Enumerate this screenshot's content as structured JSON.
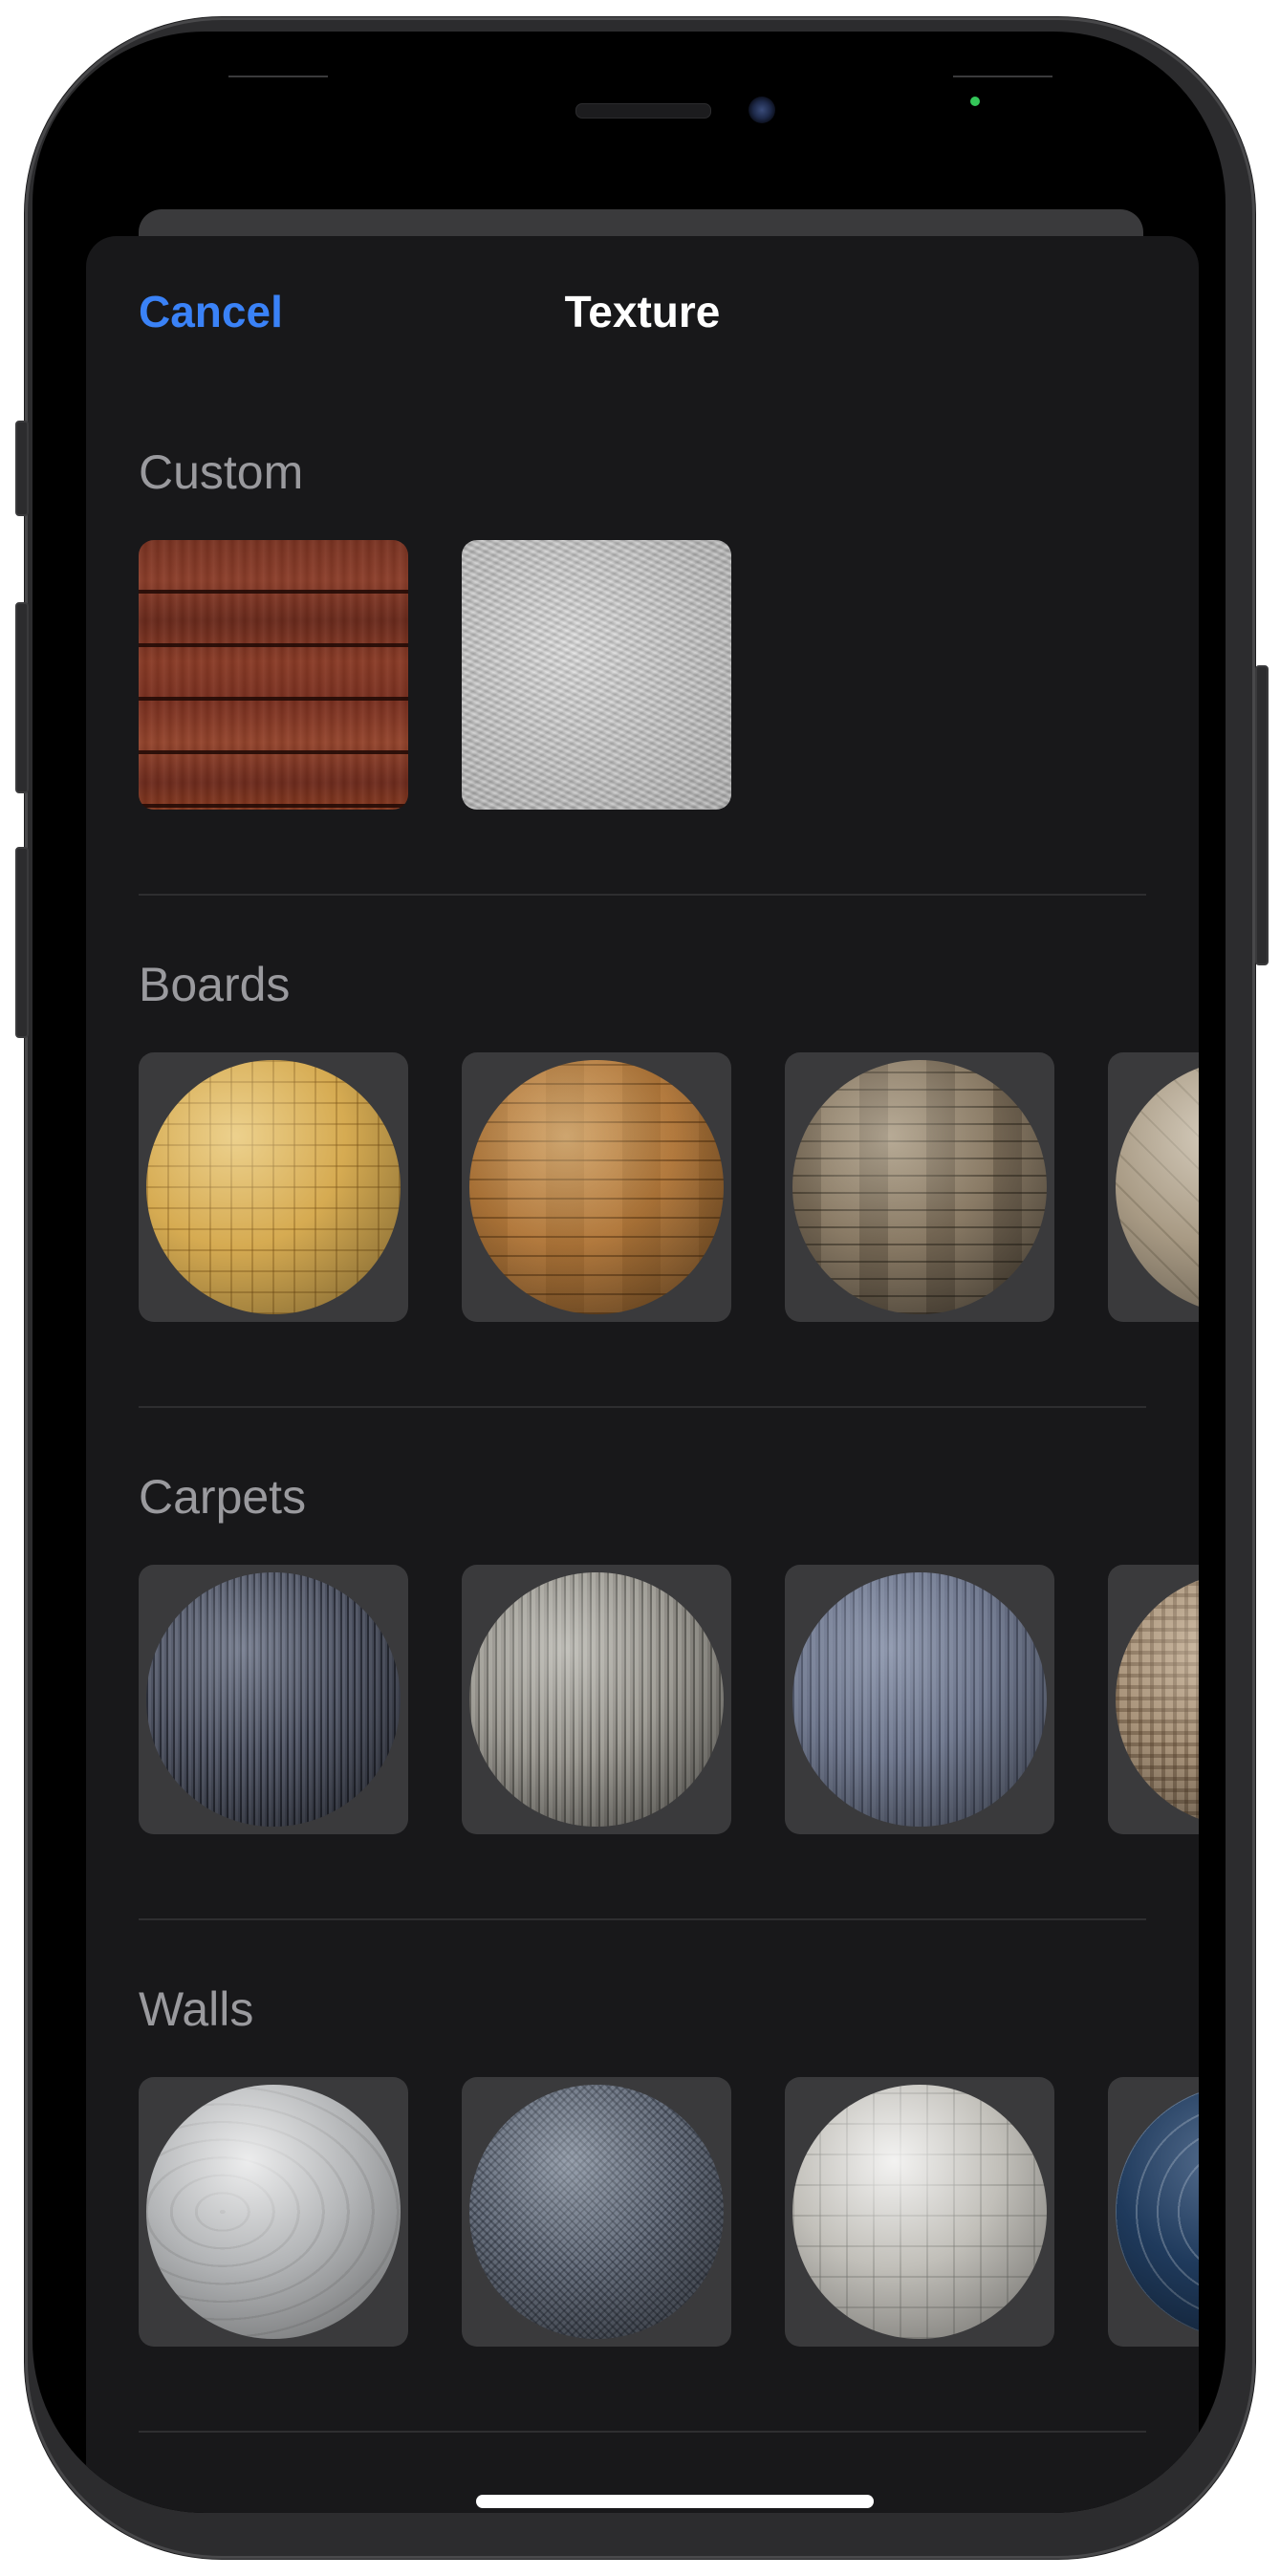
{
  "nav": {
    "cancel_label": "Cancel",
    "title": "Texture"
  },
  "sections": [
    {
      "title": "Custom",
      "items": [
        "wood-planks-texture",
        "white-fur-texture"
      ]
    },
    {
      "title": "Boards",
      "items": [
        "light-parquet-sphere",
        "oak-boards-sphere",
        "grey-wood-sphere",
        "beige-parquet-sphere"
      ]
    },
    {
      "title": "Carpets",
      "items": [
        "dark-carpet-sphere",
        "light-carpet-sphere",
        "blue-carpet-sphere",
        "checked-carpet-sphere"
      ]
    },
    {
      "title": "Walls",
      "items": [
        "silver-wall-sphere",
        "slate-wall-sphere",
        "tile-wall-sphere",
        "navy-wall-sphere"
      ]
    }
  ],
  "colors": {
    "accent": "#3a82f7",
    "sheet_background": "#18181a",
    "tile_background": "#3a3a3c",
    "section_title": "#9a9a9e"
  }
}
